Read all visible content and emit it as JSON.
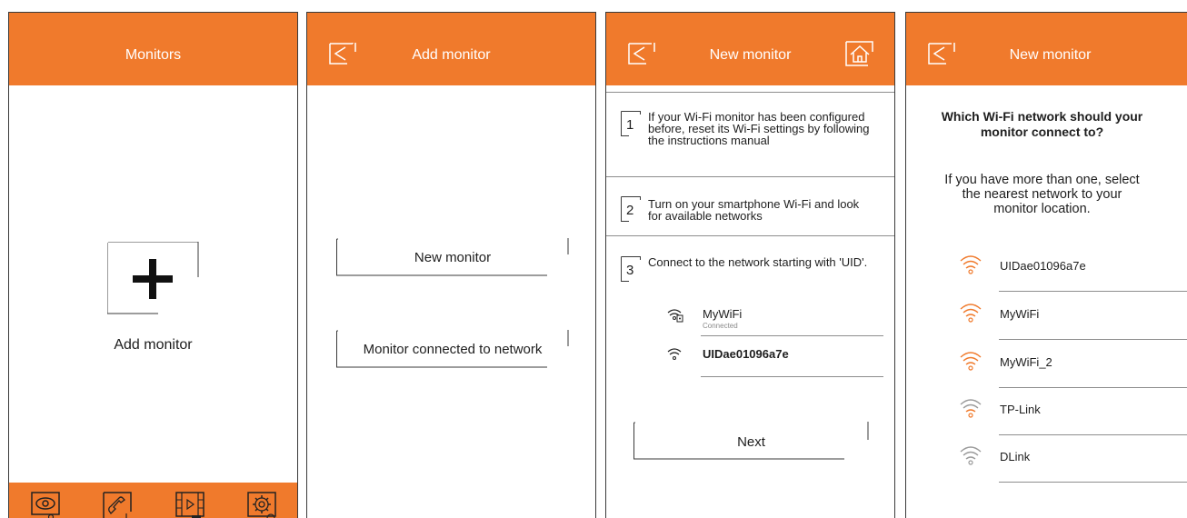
{
  "screens": {
    "monitors": {
      "title": "Monitors",
      "add_label": "Add monitor",
      "footer_icons": [
        "monitor-view-icon",
        "call-icon",
        "media-gallery-icon",
        "settings-icon"
      ]
    },
    "add_monitor": {
      "title": "Add monitor",
      "new_monitor_btn": "New monitor",
      "connected_btn": "Monitor connected to network"
    },
    "new_monitor_steps": {
      "title": "New monitor",
      "steps": [
        {
          "num": "1",
          "text": "If your Wi-Fi monitor has been configured before, reset its Wi-Fi settings by following the instructions manual"
        },
        {
          "num": "2",
          "text": "Turn on your smartphone Wi-Fi and look for available networks"
        },
        {
          "num": "3",
          "text": "Connect to the network starting with 'UID'."
        }
      ],
      "networks": [
        {
          "name": "MyWiFi",
          "status": "Connected"
        },
        {
          "name": "UIDae01096a7e"
        }
      ],
      "next_btn": "Next"
    },
    "choose_network": {
      "title": "New monitor",
      "question": "Which Wi-Fi network should your monitor connect to?",
      "hint": "If you have more than one, select the nearest network to your monitor location.",
      "networks": [
        "UIDae01096a7e",
        "MyWiFi",
        "MyWiFi_2",
        "TP-Link",
        "DLink"
      ]
    }
  },
  "colors": {
    "accent": "#f07a2c",
    "text": "#1e1e1e",
    "line": "#8d8d8d",
    "wifi_weak": "#9a9a9a"
  }
}
